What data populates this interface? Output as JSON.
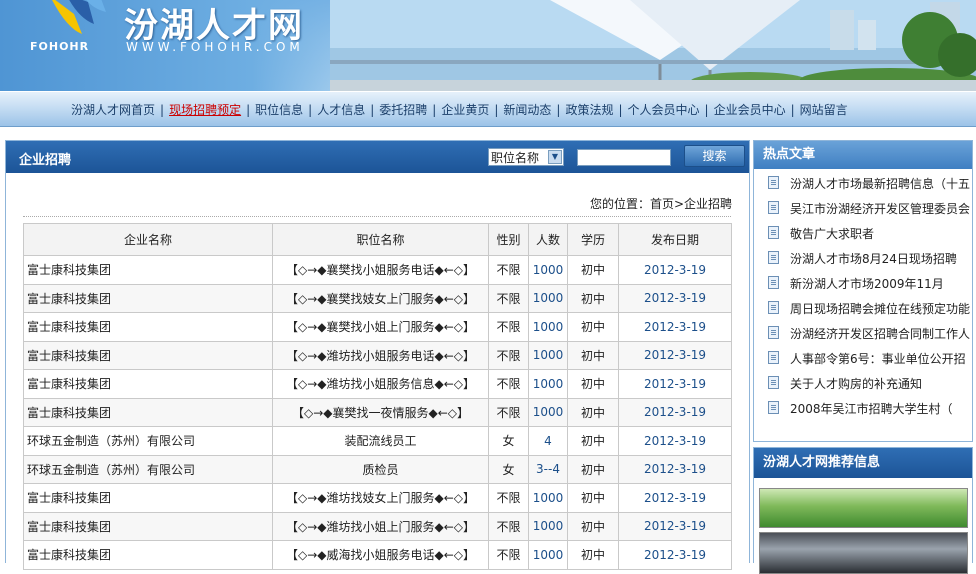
{
  "header": {
    "logo_cn": "汾湖人才网",
    "logo_en": "FOHOHR",
    "logo_url": "WWW.FOHOHR.COM"
  },
  "nav": {
    "items": [
      {
        "label": "汾湖人才网首页"
      },
      {
        "label": "现场招聘预定",
        "hot": true
      },
      {
        "label": "职位信息"
      },
      {
        "label": "人才信息"
      },
      {
        "label": "委托招聘"
      },
      {
        "label": "企业黄页"
      },
      {
        "label": "新闻动态"
      },
      {
        "label": "政策法规"
      },
      {
        "label": "个人会员中心"
      },
      {
        "label": "企业会员中心"
      },
      {
        "label": "网站留言"
      }
    ]
  },
  "main": {
    "title": "企业招聘",
    "search": {
      "select_value": "职位名称",
      "input_value": "",
      "button_label": "搜索"
    },
    "location": "您的位置：首页>企业招聘",
    "table": {
      "headers": [
        "企业名称",
        "职位名称",
        "性别",
        "人数",
        "学历",
        "发布日期"
      ],
      "rows": [
        [
          "富士康科技集团",
          "【◇→◆襄樊找小姐服务电话◆←◇】",
          "不限",
          "1000",
          "初中",
          "2012-3-19"
        ],
        [
          "富士康科技集团",
          "【◇→◆襄樊找妓女上门服务◆←◇】",
          "不限",
          "1000",
          "初中",
          "2012-3-19"
        ],
        [
          "富士康科技集团",
          "【◇→◆襄樊找小姐上门服务◆←◇】",
          "不限",
          "1000",
          "初中",
          "2012-3-19"
        ],
        [
          "富士康科技集团",
          "【◇→◆潍坊找小姐服务电话◆←◇】",
          "不限",
          "1000",
          "初中",
          "2012-3-19"
        ],
        [
          "富士康科技集团",
          "【◇→◆潍坊找小姐服务信息◆←◇】",
          "不限",
          "1000",
          "初中",
          "2012-3-19"
        ],
        [
          "富士康科技集团",
          "【◇→◆襄樊找一夜情服务◆←◇】",
          "不限",
          "1000",
          "初中",
          "2012-3-19"
        ],
        [
          "环球五金制造（苏州）有限公司",
          "装配流线员工",
          "女",
          "4",
          "初中",
          "2012-3-19"
        ],
        [
          "环球五金制造（苏州）有限公司",
          "质检员",
          "女",
          "3--4",
          "初中",
          "2012-3-19"
        ],
        [
          "富士康科技集团",
          "【◇→◆潍坊找妓女上门服务◆←◇】",
          "不限",
          "1000",
          "初中",
          "2012-3-19"
        ],
        [
          "富士康科技集团",
          "【◇→◆潍坊找小姐上门服务◆←◇】",
          "不限",
          "1000",
          "初中",
          "2012-3-19"
        ],
        [
          "富士康科技集团",
          "【◇→◆威海找小姐服务电话◆←◇】",
          "不限",
          "1000",
          "初中",
          "2012-3-19"
        ]
      ]
    }
  },
  "sidebar": {
    "hot_title": "热点文章",
    "hot_items": [
      "汾湖人才市场最新招聘信息（十五",
      "吴江市汾湖经济开发区管理委员会",
      "敬告广大求职者",
      "汾湖人才市场8月24日现场招聘",
      "新汾湖人才市场2009年11月",
      "周日现场招聘会摊位在线预定功能",
      "汾湖经济开发区招聘合同制工作人",
      "人事部令第6号：事业单位公开招",
      "关于人才购房的补充通知",
      "2008年吴江市招聘大学生村（"
    ],
    "rec_title": "汾湖人才网推荐信息"
  }
}
